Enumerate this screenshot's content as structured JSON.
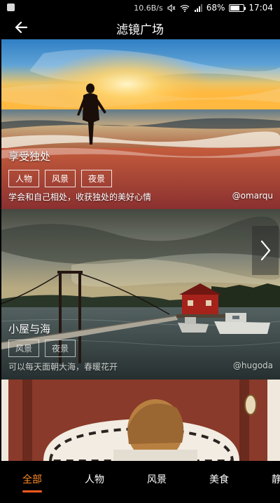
{
  "status_bar": {
    "speed": "10.6B/s",
    "battery": "68%",
    "time": "17:04"
  },
  "title_bar": {
    "title": "滤镜广场",
    "back_icon": "arrow-left-icon"
  },
  "cards": [
    {
      "caption": "享受独处",
      "tags": [
        "人物",
        "风景",
        "夜景"
      ],
      "description": "学会和自己相处，收获独处的美好心情",
      "author": "@omarqu"
    },
    {
      "caption": "小屋与海",
      "tags": [
        "风景",
        "夜景"
      ],
      "description": "可以每天面朝大海，春暖花开",
      "author": "@hugoda"
    }
  ],
  "next_icon": "chevron-right-icon",
  "tabs": {
    "items": [
      "全部",
      "人物",
      "风景",
      "美食",
      "静"
    ],
    "active": "全部"
  },
  "colors": {
    "accent": "#ff8a26",
    "underline": "#ff5a1f"
  }
}
